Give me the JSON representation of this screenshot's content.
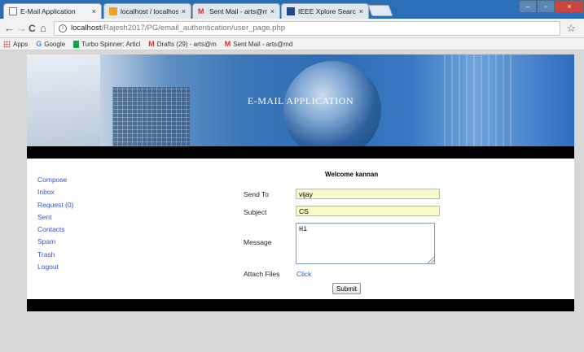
{
  "browser": {
    "tabs": [
      {
        "label": "E-Mail Application",
        "icon": "page-icon",
        "active": true
      },
      {
        "label": "localhost / localhost / ga",
        "icon": "phpmyadmin-icon",
        "active": false
      },
      {
        "label": "Sent Mail - arts@mdcen",
        "icon": "gmail-icon",
        "active": false
      },
      {
        "label": "IEEE Xplore Search Resul",
        "icon": "ieee-icon",
        "active": false
      }
    ],
    "close_glyph": "×",
    "address": {
      "host": "localhost",
      "path": "/Rajesh2017/PG/email_authentication/user_page.php"
    },
    "bookmarks": [
      {
        "label": "Apps",
        "icon": "apps-icon"
      },
      {
        "label": "Google",
        "icon": "google-icon"
      },
      {
        "label": "Turbo Spinner: Articl",
        "icon": "turbo-spinner-icon"
      },
      {
        "label": "Drafts (29) - arts@m",
        "icon": "gmail-icon"
      },
      {
        "label": "Sent Mail - arts@md",
        "icon": "gmail-icon"
      }
    ],
    "nav": {
      "back": "←",
      "forward": "→",
      "reload": "C",
      "home": "⌂",
      "star": "☆",
      "info": "i"
    }
  },
  "page": {
    "banner_title": "E-MAIL APPLICATION",
    "welcome": "Welcome kannan",
    "sidebar": [
      "Compose",
      "Inbox",
      "Request (0)",
      "Sent",
      "Contacts",
      "Spam",
      "Trash",
      "Logout"
    ],
    "form": {
      "send_to_label": "Send To",
      "send_to_value": "vijay",
      "subject_label": "Subject",
      "subject_value": "CS",
      "message_label": "Message",
      "message_value": "Hi",
      "attach_label": "Attach Files",
      "attach_link": "Click",
      "submit_label": "Submit"
    }
  },
  "colors": {
    "tabbar": "#2a6fb5",
    "link": "#3355cc",
    "input_bg": "#fafac8",
    "band": "#000000"
  }
}
